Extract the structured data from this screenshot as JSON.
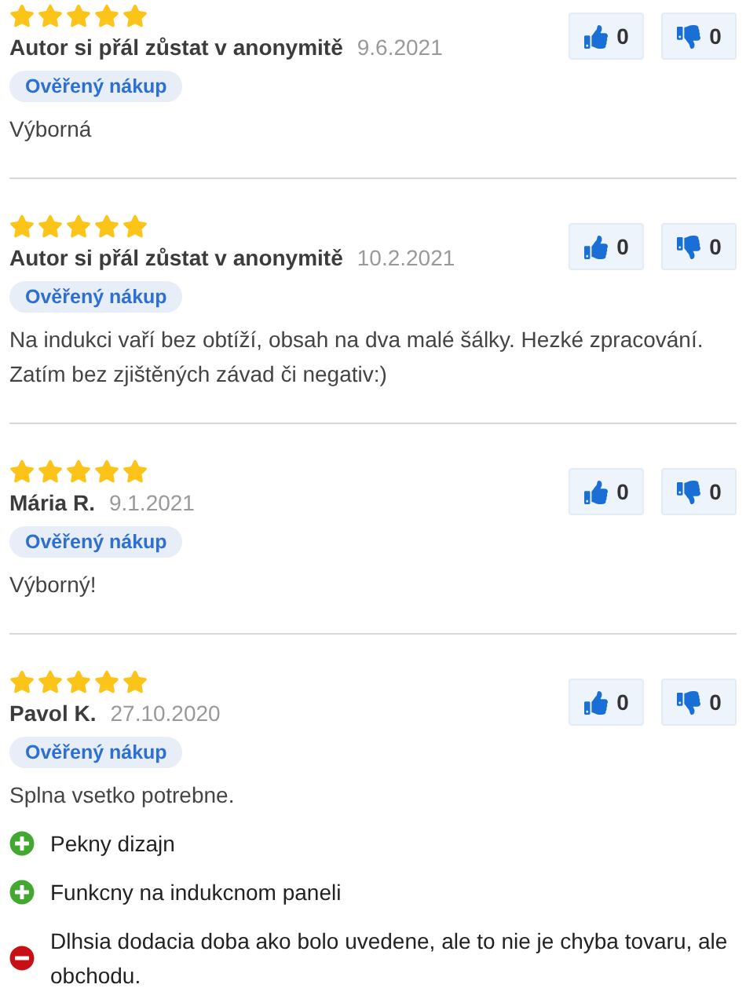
{
  "reviews": [
    {
      "stars": 5,
      "author": "Autor si přál zůstat v anonymitě",
      "date": "9.6.2021",
      "badge": "Ověřený nákup",
      "text": "Výborná",
      "likes": "0",
      "dislikes": "0"
    },
    {
      "stars": 5,
      "author": "Autor si přál zůstat v anonymitě",
      "date": "10.2.2021",
      "badge": "Ověřený nákup",
      "text": "Na indukci vaří bez obtíží, obsah na dva malé šálky. Hezké zpracování. Zatím bez zjištěných závad či negativ:)",
      "likes": "0",
      "dislikes": "0"
    },
    {
      "stars": 5,
      "author": "Mária R.",
      "date": "9.1.2021",
      "badge": "Ověřený nákup",
      "text": "Výborný!",
      "likes": "0",
      "dislikes": "0"
    },
    {
      "stars": 5,
      "author": "Pavol K.",
      "date": "27.10.2020",
      "badge": "Ověřený nákup",
      "text": "Splna vsetko potrebne.",
      "likes": "0",
      "dislikes": "0",
      "points": [
        {
          "kind": "pro",
          "text": "Pekny dizajn"
        },
        {
          "kind": "pro",
          "text": "Funkcny na indukcnom paneli"
        },
        {
          "kind": "con",
          "text": "Dlhsia dodacia doba ako bolo uvedene, ale to nie je chyba tovaru, ale obchodu."
        }
      ]
    }
  ]
}
